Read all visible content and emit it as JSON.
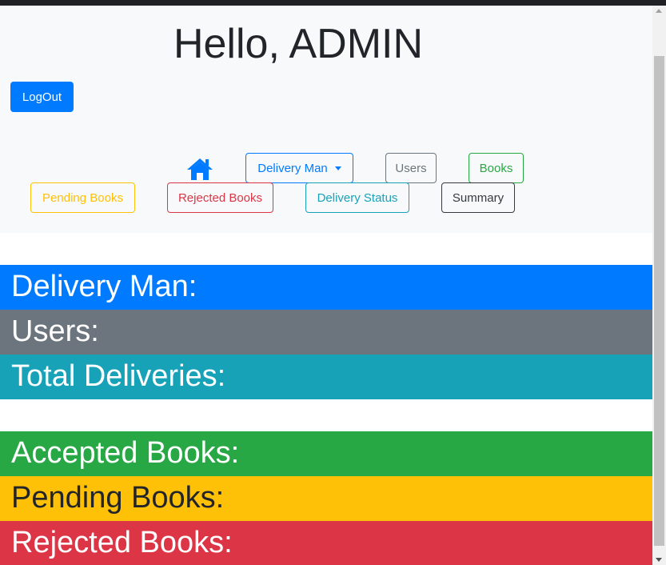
{
  "header": {
    "greeting": "Hello, ADMIN",
    "logout_label": "LogOut"
  },
  "nav": {
    "home_icon": "home-icon",
    "delivery_man_label": "Delivery Man",
    "users_label": "Users",
    "books_label": "Books",
    "pending_books_label": "Pending Books",
    "rejected_books_label": "Rejected Books",
    "delivery_status_label": "Delivery Status",
    "summary_label": "Summary"
  },
  "summary": {
    "delivery_man": "Delivery Man:",
    "users": "Users:",
    "total_deliveries": "Total Deliveries:",
    "accepted_books": "Accepted Books:",
    "pending_books": "Pending Books:",
    "rejected_books": "Rejected Books:"
  },
  "colors": {
    "primary": "#007bff",
    "secondary": "#6c757d",
    "success": "#28a745",
    "warning": "#ffc107",
    "danger": "#dc3545",
    "info": "#17a2b8",
    "dark": "#343a40"
  }
}
